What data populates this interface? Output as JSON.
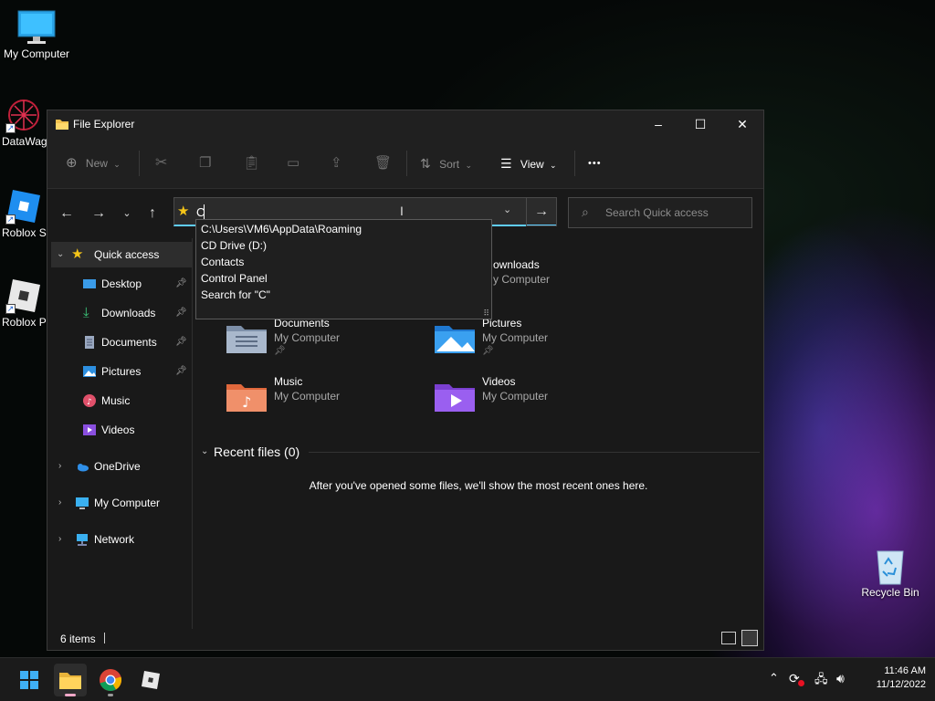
{
  "desktop": {
    "icons": [
      {
        "label": "My Computer"
      },
      {
        "label": "DataWag"
      },
      {
        "label": "Roblox St"
      },
      {
        "label": "Roblox Pl"
      },
      {
        "label": "Recycle Bin"
      }
    ]
  },
  "window": {
    "title": "File Explorer",
    "controls": {
      "minimize": "–",
      "maximize": "☐",
      "close": "✕"
    }
  },
  "command_bar": {
    "new_label": "New",
    "sort_label": "Sort",
    "view_label": "View",
    "more": "•••"
  },
  "address": {
    "value": "C",
    "dropdown_items": [
      "C:\\Users\\VM6\\AppData\\Roaming",
      "CD Drive (D:)",
      "Contacts",
      "Control Panel",
      "Search for \"C\""
    ]
  },
  "search": {
    "placeholder": "Search Quick access"
  },
  "sidebar": {
    "quick_access": "Quick access",
    "items": [
      {
        "label": "Desktop",
        "icon": "desktop-icon",
        "pinned": true
      },
      {
        "label": "Downloads",
        "icon": "download-icon",
        "pinned": true
      },
      {
        "label": "Documents",
        "icon": "document-icon",
        "pinned": true
      },
      {
        "label": "Pictures",
        "icon": "pictures-icon",
        "pinned": true
      },
      {
        "label": "Music",
        "icon": "music-icon",
        "pinned": false
      },
      {
        "label": "Videos",
        "icon": "videos-icon",
        "pinned": false
      }
    ],
    "onedrive": "OneDrive",
    "my_computer": "My Computer",
    "network": "Network"
  },
  "folders": [
    {
      "name": "Downloads",
      "location": "My Computer",
      "pinned": false,
      "partial_name": "ownloads",
      "partial_location": "y Computer"
    },
    {
      "name": "Documents",
      "location": "My Computer",
      "pinned": true
    },
    {
      "name": "Pictures",
      "location": "My Computer",
      "pinned": true
    },
    {
      "name": "Music",
      "location": "My Computer",
      "pinned": false
    },
    {
      "name": "Videos",
      "location": "My Computer",
      "pinned": false
    }
  ],
  "recent": {
    "heading": "Recent files (0)",
    "empty_message": "After you've opened some files, we'll show the most recent ones here."
  },
  "status": {
    "items": "6 items"
  },
  "taskbar": {
    "time": "11:46 AM",
    "date": "11/12/2022"
  },
  "colors": {
    "accent": "#60cdff",
    "window_bg": "#191919",
    "titlebar_bg": "#202020",
    "taskbar_bg": "#1b1b1b"
  }
}
